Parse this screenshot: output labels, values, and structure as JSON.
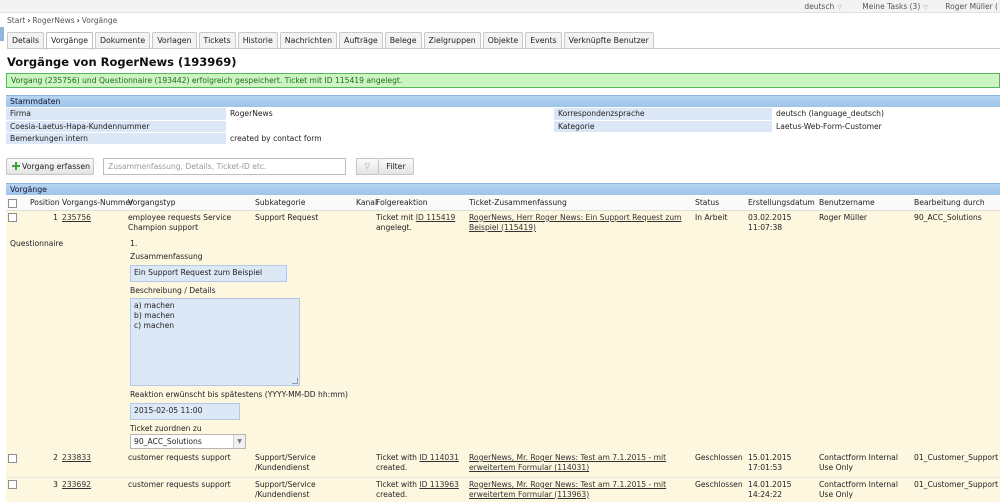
{
  "topbar": {
    "language": "deutsch",
    "tasks": "Meine Tasks (3)",
    "user": "Roger Müller ("
  },
  "breadcrumb": [
    "Start",
    "RogerNews",
    "Vorgänge"
  ],
  "tabs": [
    "Details",
    "Vorgänge",
    "Dokumente",
    "Vorlagen",
    "Tickets",
    "Historie",
    "Nachrichten",
    "Aufträge",
    "Belege",
    "Zielgruppen",
    "Objekte",
    "Events",
    "Verknüpfte Benutzer"
  ],
  "page_title": "Vorgänge von RogerNews (193969)",
  "success_message": "Vorgang (235756) und Questionnaire (193442) erfolgreich gespeichert. Ticket mit ID 115419 angelegt.",
  "stammdaten": {
    "heading": "Stammdaten",
    "firma_label": "Firma",
    "firma_value": "RogerNews",
    "korr_label": "Korrespondenzsprache",
    "korr_value": "deutsch (language_deutsch)",
    "kd_label": "Coesia-Laetus-Hapa-Kundennummer",
    "kd_value": "",
    "kat_label": "Kategorie",
    "kat_value": "Laetus-Web-Form-Customer",
    "bem_label": "Bemerkungen intern",
    "bem_value": "created by contact form"
  },
  "actions": {
    "create_label": "Vorgang erfassen",
    "search_placeholder": "Zusammenfassung, Details, Ticket-ID etc.",
    "filter_label": "Filter"
  },
  "vorgaenge": {
    "heading": "Vorgänge",
    "columns": [
      "Position",
      "Vorgangs-Nummer",
      "Vorgangstyp",
      "Subkategorie",
      "Kanal",
      "Folgereaktion",
      "Ticket-Zusammenfassung",
      "Status",
      "Erstellungsdatum",
      "Benutzername",
      "Bearbeitung durch"
    ],
    "rows": [
      {
        "pos": "1",
        "nr": "235756",
        "typ": "employee requests Service Champion support",
        "sub": "Support Request",
        "kanal": "",
        "folge_pre": "Ticket mit",
        "folge_id": "ID 115419",
        "folge_post": "angelegt.",
        "summary": "RogerNews, Herr Roger News: Ein Support Request zum Beispiel (115419)",
        "status": "In Arbeit",
        "date": "03.02.2015",
        "time": "11:07:38",
        "user": "Roger Müller",
        "bearb": "90_ACC_Solutions"
      },
      {
        "pos": "2",
        "nr": "233833",
        "typ": "customer requests support",
        "sub": "Support/Service /Kundendienst",
        "kanal": "",
        "folge_pre": "Ticket with",
        "folge_id": "ID 114031",
        "folge_post": "created.",
        "summary": "RogerNews, Mr. Roger News: Test am 7.1.2015 - mit erweitertem Formular (114031)",
        "status": "Geschlossen",
        "date": "15.01.2015",
        "time": "17:01:53",
        "user": "Contactform Internal Use Only",
        "bearb": "01_Customer_Support"
      },
      {
        "pos": "3",
        "nr": "233692",
        "typ": "customer requests support",
        "sub": "Support/Service /Kundendienst",
        "kanal": "",
        "folge_pre": "Ticket with",
        "folge_id": "ID 113963",
        "folge_post": "created.",
        "summary": "RogerNews, Mr. Roger News: Test am 7.1.2015 - mit erweitertem Formular (113963)",
        "status": "Geschlossen",
        "date": "14.01.2015",
        "time": "14:24:22",
        "user": "Contactform Internal Use Only",
        "bearb": "01_Customer_Support"
      }
    ]
  },
  "questionnaire": {
    "label": "Questionnaire",
    "index": "1.",
    "summary_label": "Zusammenfassung",
    "summary_value": "Ein Support Request zum Beispiel",
    "details_label": "Beschreibung / Details",
    "details_lines": [
      "a) machen",
      "b) machen",
      "c) machen"
    ],
    "reaction_label": "Reaktion erwünscht bis spätestens (YYYY-MM-DD hh:mm)",
    "reaction_value": "2015-02-05 11:00",
    "assign_label": "Ticket zuordnen zu",
    "assign_value": "90_ACC_Solutions"
  }
}
